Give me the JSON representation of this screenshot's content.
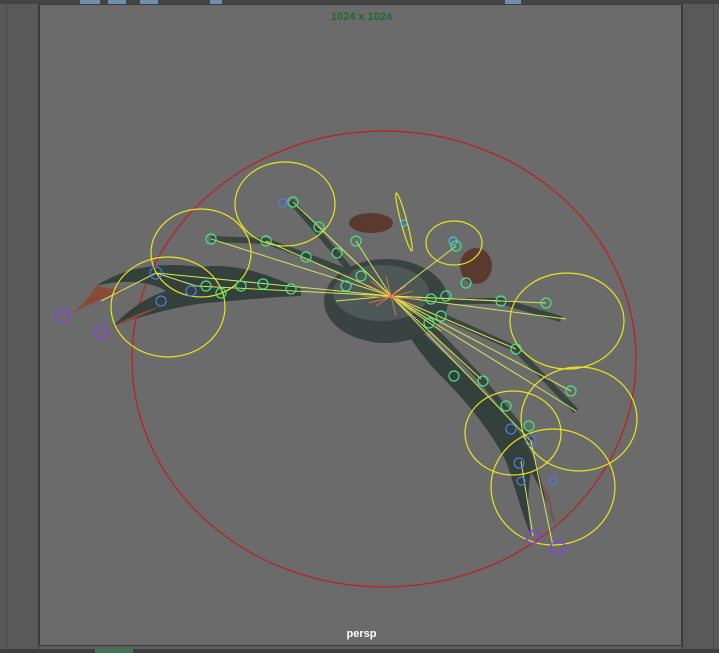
{
  "window": {
    "panel": "model-panel"
  },
  "viewport": {
    "resolution_gate_label": "1024 x 1024",
    "camera_name": "persp",
    "scene_object": "crab-rig",
    "colors": {
      "background": "#6b6b6b",
      "resolution_text": "#1d6b2f",
      "camera_text": "#ffffff",
      "master_control": "#c21e1e",
      "ik_controls": "#e6e61e",
      "joints": "#3ee68a",
      "ik_handles": "#8a3ee6",
      "claw_joints": "#4a7ee6",
      "bones": "#d2e65a",
      "center_pivots": "#e67a3e"
    }
  },
  "toolbar": {
    "icons": [
      "shelf-icon",
      "shelf-icon",
      "shelf-icon",
      "shelf-icon",
      "shelf-icon"
    ]
  },
  "bottom_bar": {
    "icons": [
      "time-slider-tab"
    ]
  }
}
